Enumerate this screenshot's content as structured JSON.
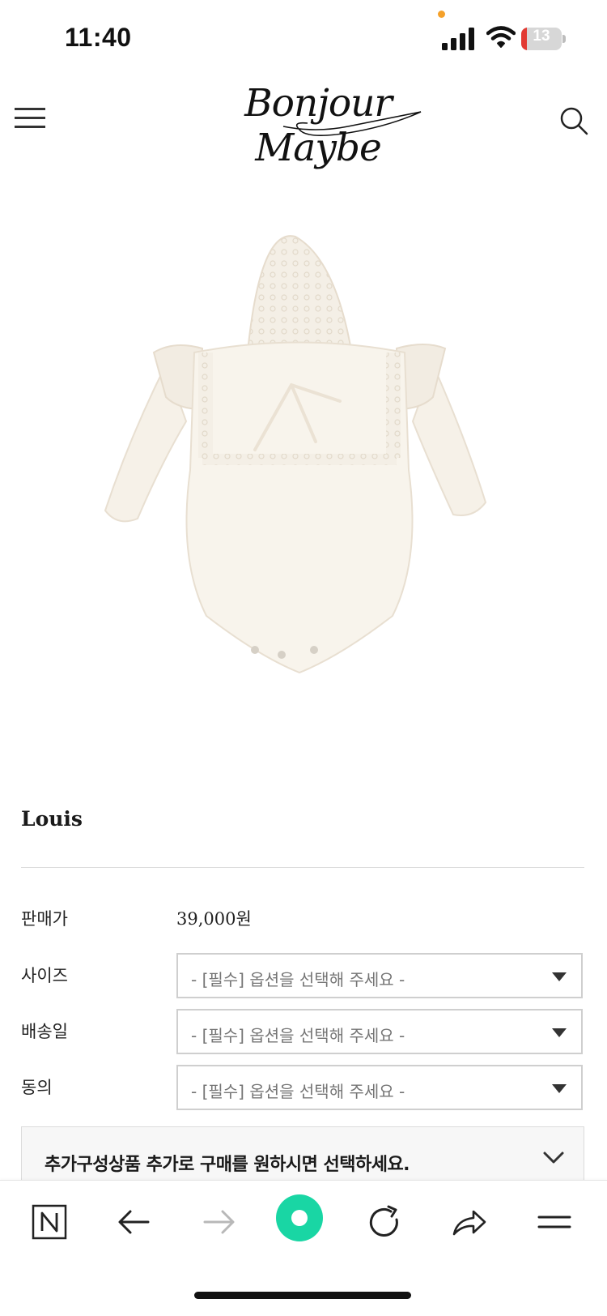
{
  "status_bar": {
    "time": "11:40",
    "battery_level": "13",
    "battery_percent": 13,
    "battery_color": "#e23a33",
    "privacy_dot_color": "#f5a12a"
  },
  "header": {
    "logo_text": "Bonjour Maybe",
    "menu_icon": "hamburger-icon",
    "search_icon": "search-icon"
  },
  "product": {
    "name": "Louis",
    "image_alt": "lace-bonnet-and-ruffle-romper-photo",
    "price_label": "판매가",
    "price_value": "39,000원",
    "options": [
      {
        "label": "사이즈",
        "placeholder": "- [필수] 옵션을 선택해 주세요 -"
      },
      {
        "label": "배송일",
        "placeholder": "- [필수] 옵션을 선택해 주세요 -"
      },
      {
        "label": "동의",
        "placeholder": "- [필수] 옵션을 선택해 주세요 -"
      }
    ],
    "addon_text": "추가구성상품 추가로 구매를 원하시면 선택하세요."
  },
  "browser_toolbar": {
    "items": [
      "naver-home-icon",
      "back-arrow-icon",
      "forward-arrow-icon",
      "green-dot-icon",
      "refresh-icon",
      "share-icon",
      "more-menu-icon"
    ],
    "accent_color": "#19d6a4"
  }
}
